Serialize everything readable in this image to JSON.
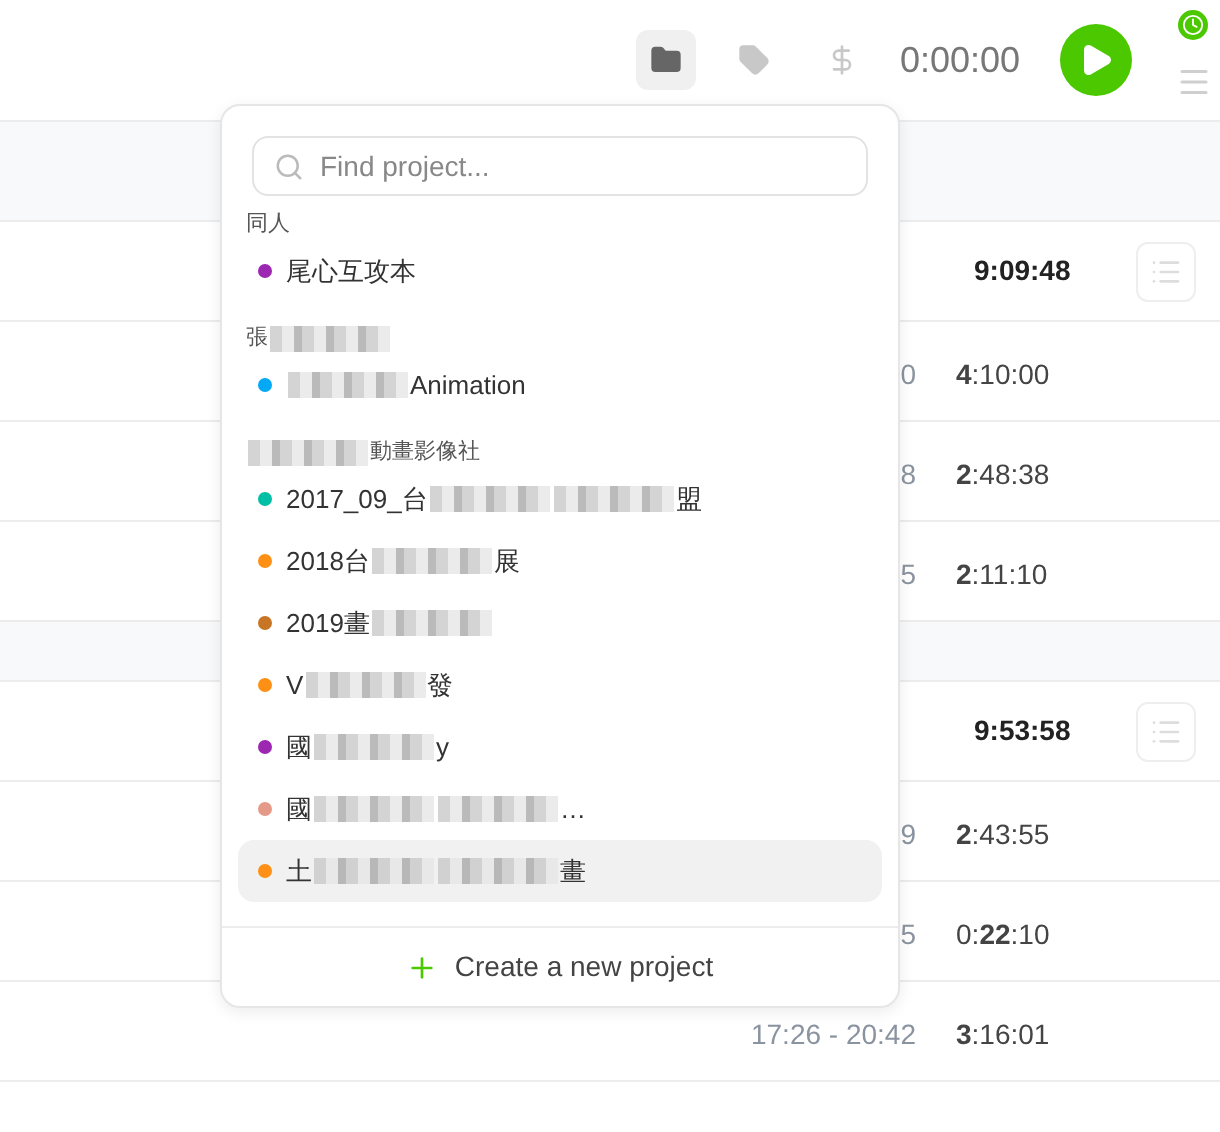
{
  "header": {
    "tools": [
      {
        "kind": "folder",
        "selected": true
      },
      {
        "kind": "tag",
        "selected": false
      },
      {
        "kind": "dollar",
        "selected": false
      }
    ],
    "timer": "0:00:00"
  },
  "days": [
    {
      "total": "9:09:48",
      "rows": [
        {
          "range": "0",
          "duration": "**4**:10:00"
        },
        {
          "range": "8",
          "duration": "**2**:48:38"
        },
        {
          "range": "5",
          "duration": "**2**:11:10"
        }
      ]
    },
    {
      "total": "9:53:58",
      "rows": [
        {
          "range": "9",
          "duration": "**2**:43:55"
        },
        {
          "range": "5",
          "duration": "0:**22**:10"
        },
        {
          "range": "17:26 - 20:42",
          "duration": "**3**:16:01"
        }
      ]
    }
  ],
  "project_picker": {
    "search": {
      "placeholder": "Find project..."
    },
    "groups": [
      {
        "label": [
          {
            "kind": "text",
            "text": "同人"
          }
        ],
        "projects": [
          {
            "color": "#9c27b0",
            "highlighted": false,
            "parts": [
              {
                "kind": "text",
                "text": "尾心互攻本"
              }
            ]
          }
        ]
      },
      {
        "label": [
          {
            "kind": "text",
            "text": "張"
          },
          {
            "kind": "redacted"
          }
        ],
        "projects": [
          {
            "color": "#03a9f4",
            "highlighted": false,
            "parts": [
              {
                "kind": "redacted"
              },
              {
                "kind": "text",
                "text": "Animation"
              }
            ]
          }
        ]
      },
      {
        "label": [
          {
            "kind": "redacted"
          },
          {
            "kind": "text",
            "text": "動畫影像社"
          }
        ],
        "projects": [
          {
            "color": "#00bfa5",
            "highlighted": false,
            "parts": [
              {
                "kind": "text",
                "text": "2017_09_台"
              },
              {
                "kind": "redacted"
              },
              {
                "kind": "redacted"
              },
              {
                "kind": "text",
                "text": "盟"
              }
            ]
          },
          {
            "color": "#ff9016",
            "highlighted": false,
            "parts": [
              {
                "kind": "text",
                "text": "2018台"
              },
              {
                "kind": "redacted"
              },
              {
                "kind": "text",
                "text": "展"
              }
            ]
          },
          {
            "color": "#c87525",
            "highlighted": false,
            "parts": [
              {
                "kind": "text",
                "text": "2019畫"
              },
              {
                "kind": "redacted"
              }
            ]
          },
          {
            "color": "#ff9016",
            "highlighted": false,
            "parts": [
              {
                "kind": "text",
                "text": "V"
              },
              {
                "kind": "redacted"
              },
              {
                "kind": "text",
                "text": "發"
              }
            ]
          },
          {
            "color": "#9c27b0",
            "highlighted": false,
            "parts": [
              {
                "kind": "text",
                "text": "國"
              },
              {
                "kind": "redacted"
              },
              {
                "kind": "text",
                "text": "y"
              }
            ]
          },
          {
            "color": "#e59a89",
            "highlighted": false,
            "parts": [
              {
                "kind": "text",
                "text": "國"
              },
              {
                "kind": "redacted"
              },
              {
                "kind": "redacted"
              },
              {
                "kind": "text",
                "text": "…"
              }
            ]
          },
          {
            "color": "#ff9016",
            "highlighted": true,
            "parts": [
              {
                "kind": "text",
                "text": "土"
              },
              {
                "kind": "redacted"
              },
              {
                "kind": "redacted"
              },
              {
                "kind": "text",
                "text": "畫"
              }
            ]
          }
        ]
      }
    ],
    "create": "Create a new project"
  }
}
